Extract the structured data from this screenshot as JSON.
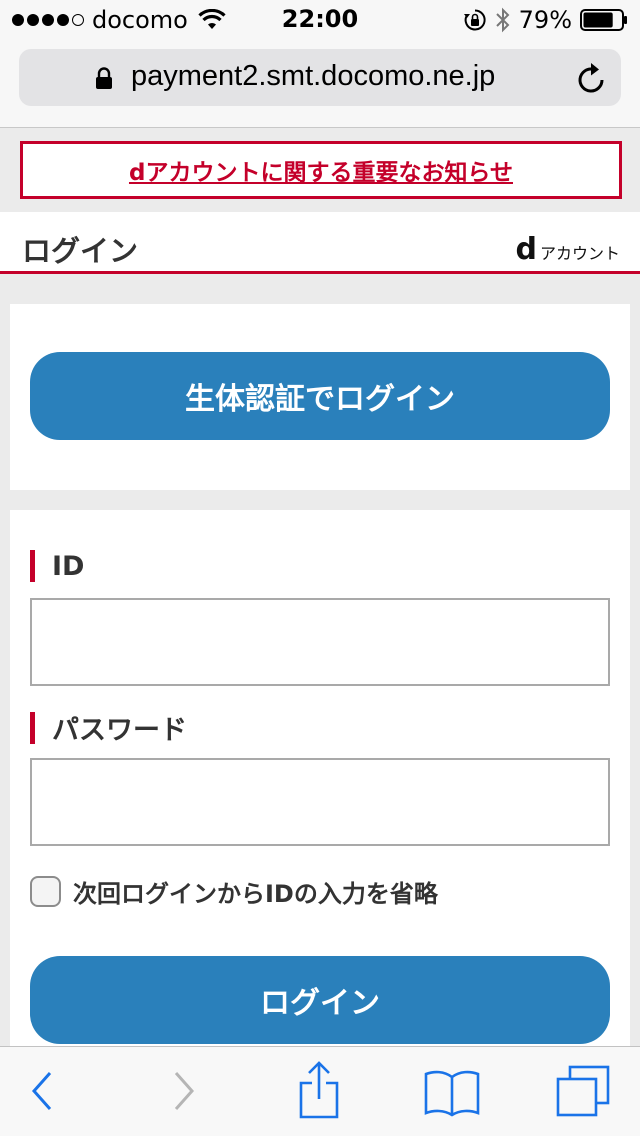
{
  "status_bar": {
    "carrier": "docomo",
    "time": "22:00",
    "battery_percent": "79%",
    "signal_bars_filled": 4,
    "signal_bars_total": 5,
    "battery_level": 0.79
  },
  "browser": {
    "url": "payment2.smt.docomo.ne.jp"
  },
  "notice": {
    "link_text": "dアカウントに関する重要なお知らせ"
  },
  "header": {
    "title": "ログイン",
    "logo_mark": "d",
    "logo_text": "アカウント"
  },
  "biometric": {
    "button_label": "生体認証でログイン"
  },
  "form": {
    "id_label": "ID",
    "id_value": "",
    "password_label": "パスワード",
    "password_value": "",
    "remember_label": "次回ログインからIDの入力を省略",
    "remember_checked": false,
    "submit_label": "ログイン"
  },
  "colors": {
    "accent_red": "#c4002a",
    "button_blue": "#2a80bb",
    "ios_blue": "#1a73e8"
  },
  "toolbar": {
    "icons": [
      "back-icon",
      "forward-icon",
      "share-icon",
      "bookmarks-icon",
      "tabs-icon"
    ]
  }
}
